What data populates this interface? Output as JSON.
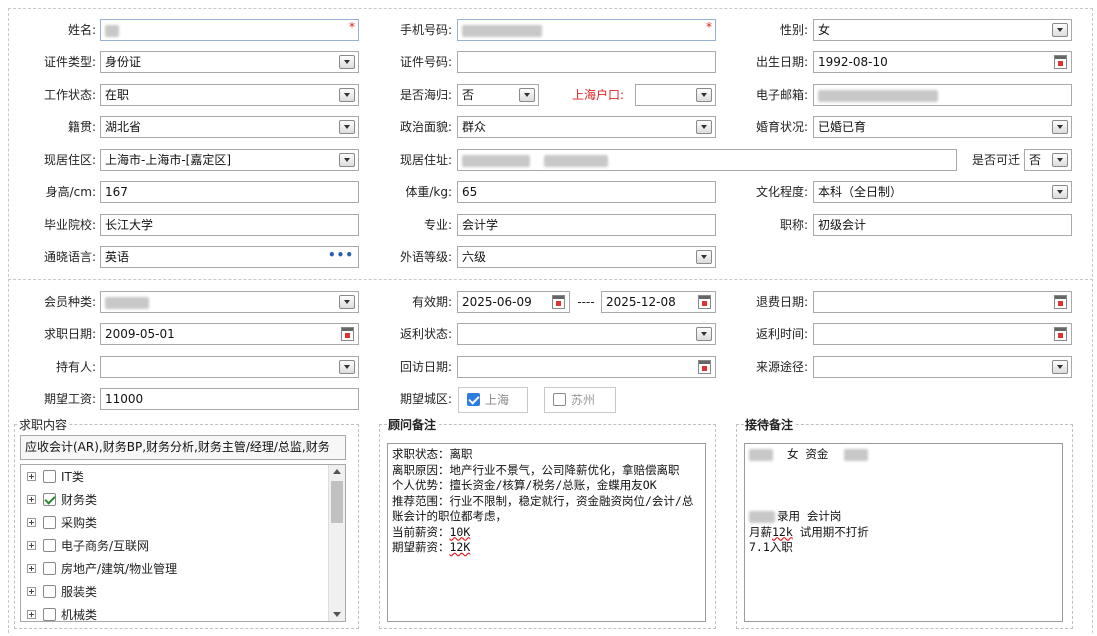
{
  "personal": {
    "name_label": "姓名:",
    "phone_label": "手机号码:",
    "gender_label": "性别:",
    "gender_value": "女",
    "id_type_label": "证件类型:",
    "id_type_value": "身份证",
    "id_number_label": "证件号码:",
    "birth_label": "出生日期:",
    "birth_value": "1992-08-10",
    "work_status_label": "工作状态:",
    "work_status_value": "在职",
    "returnee_label": "是否海归:",
    "returnee_value": "否",
    "hukou_label": "上海户口:",
    "email_label": "电子邮箱:",
    "native_label": "籍贯:",
    "native_value": "湖北省",
    "political_label": "政治面貌:",
    "political_value": "群众",
    "marital_label": "婚育状况:",
    "marital_value": "已婚已育",
    "district_label": "现居住区:",
    "district_value": "上海市-上海市-[嘉定区]",
    "address_label": "现居住址:",
    "relocate_label": "是否可迁",
    "relocate_value": "否",
    "height_label": "身高/cm:",
    "height_value": "167",
    "weight_label": "体重/kg:",
    "weight_value": "65",
    "education_label": "文化程度:",
    "education_value": "本科（全日制）",
    "school_label": "毕业院校:",
    "school_value": "长江大学",
    "major_label": "专业:",
    "major_value": "会计学",
    "title_label": "职称:",
    "title_value": "初级会计",
    "language_label": "通晓语言:",
    "language_value": "英语",
    "foreign_level_label": "外语等级:",
    "foreign_level_value": "六级"
  },
  "membership": {
    "member_type_label": "会员种类:",
    "validity_label": "有效期:",
    "validity_start": "2025-06-09",
    "validity_sep": "----",
    "validity_end": "2025-12-08",
    "refund_date_label": "退费日期:",
    "job_date_label": "求职日期:",
    "job_date_value": "2009-05-01",
    "rebate_status_label": "返利状态:",
    "rebate_time_label": "返利时间:",
    "holder_label": "持有人:",
    "visit_date_label": "回访日期:",
    "source_label": "来源途径:",
    "salary_label": "期望工资:",
    "salary_value": "11000",
    "city_label": "期望城区:",
    "city_shanghai": "上海",
    "city_suzhou": "苏州"
  },
  "job_content": {
    "legend": "求职内容",
    "summary": "应收会计(AR),财务BP,财务分析,财务主管/经理/总监,财务",
    "tree": [
      {
        "label": "IT类",
        "checked": false
      },
      {
        "label": "财务类",
        "checked": true
      },
      {
        "label": "采购类",
        "checked": false
      },
      {
        "label": "电子商务/互联网",
        "checked": false
      },
      {
        "label": "房地产/建筑/物业管理",
        "checked": false
      },
      {
        "label": "服装类",
        "checked": false
      },
      {
        "label": "机械类",
        "checked": false
      }
    ]
  },
  "consultant_note": {
    "legend": "顾问备注",
    "line1": "求职状态：离职",
    "line2": "离职原因：地产行业不景气，公司降薪优化，拿赔偿离职",
    "line3": "个人优势：擅长资金/核算/税务/总账，金蝶用友OK",
    "line4": "推荐范围：行业不限制，稳定就行，资金融资岗位/会计/总账会计的职位都考虑，",
    "line5a": "当前薪资：",
    "line5b": "10K",
    "line6a": "期望薪资：",
    "line6b": "12K"
  },
  "reception_note": {
    "legend": "接待备注",
    "line1": "女 资金",
    "line2": "录用 会计岗",
    "line3a": "月薪",
    "line3b": "12k",
    "line3c": " 试用期不打折",
    "line4": "7.1入职"
  },
  "icons": {
    "dropdown": "chevron-down-icon",
    "calendar": "calendar-icon",
    "more": "more-dots-icon",
    "expand": "plus-expand-icon"
  },
  "colors": {
    "required_star": "#e02020",
    "checkbox_checked": "#2f7de1",
    "more_dots": "#2a5db0"
  }
}
